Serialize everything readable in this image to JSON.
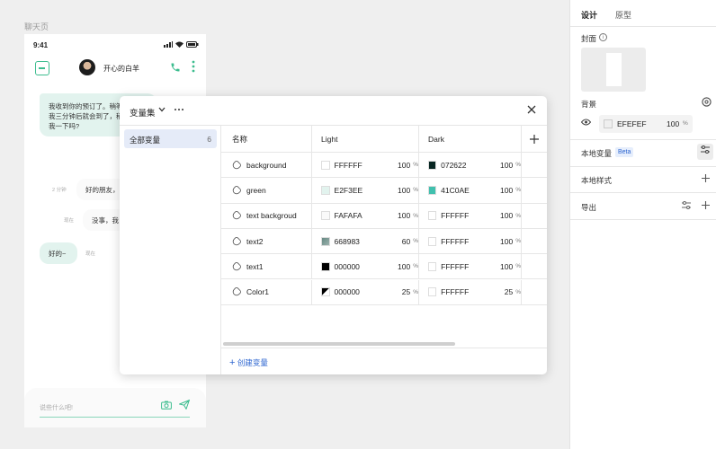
{
  "canvas": {
    "frame_label": "聊天页"
  },
  "phone": {
    "time": "9:41",
    "contact_name": "开心的白羊",
    "messages": [
      {
        "text_lines": [
          "我收到你的预订了。稍等",
          "我三分钟后就会到了，稍",
          "我一下吗?"
        ],
        "side": "left",
        "style": "green"
      },
      {
        "text": "好的朋友，",
        "time": "2 分钟",
        "style": "white"
      },
      {
        "text": "没事，我",
        "time": "现在",
        "style": "white"
      },
      {
        "text": "好的~",
        "time": "现在",
        "style": "green"
      }
    ],
    "input_placeholder": "说些什么吧!"
  },
  "modal": {
    "title": "变量集",
    "collections": [
      {
        "label": "全部变量",
        "count": "6"
      }
    ],
    "columns": {
      "name": "名称",
      "light": "Light",
      "dark": "Dark"
    },
    "pct_symbol": "%",
    "rows": [
      {
        "name": "background",
        "light": {
          "hex": "FFFFFF",
          "opacity": "100",
          "color": "#FFFFFF"
        },
        "dark": {
          "hex": "072622",
          "opacity": "100",
          "color": "#072622"
        }
      },
      {
        "name": "green",
        "light": {
          "hex": "E2F3EE",
          "opacity": "100",
          "color": "#E2F3EE"
        },
        "dark": {
          "hex": "41C0AE",
          "opacity": "100",
          "color": "#41C0AE"
        }
      },
      {
        "name": "text backgroud",
        "light": {
          "hex": "FAFAFA",
          "opacity": "100",
          "color": "#FAFAFA"
        },
        "dark": {
          "hex": "FFFFFF",
          "opacity": "100",
          "color": "#FFFFFF"
        }
      },
      {
        "name": "text2",
        "light": {
          "hex": "668983",
          "opacity": "60",
          "color": "#668983"
        },
        "dark": {
          "hex": "FFFFFF",
          "opacity": "100",
          "color": "#FFFFFF"
        }
      },
      {
        "name": "text1",
        "light": {
          "hex": "000000",
          "opacity": "100",
          "color": "#000000"
        },
        "dark": {
          "hex": "FFFFFF",
          "opacity": "100",
          "color": "#FFFFFF"
        }
      },
      {
        "name": "Color1",
        "light": {
          "hex": "000000",
          "opacity": "25",
          "color": "#000000"
        },
        "dark": {
          "hex": "FFFFFF",
          "opacity": "25",
          "color": "#FFFFFF"
        }
      }
    ],
    "create_label": "创建变量"
  },
  "panel": {
    "tabs": [
      "设计",
      "原型"
    ],
    "cover_title": "封面",
    "background_title": "背景",
    "background": {
      "hex": "EFEFEF",
      "opacity": "100",
      "pct": "%",
      "color": "#EFEFEF"
    },
    "local_variables": "本地变量",
    "beta": "Beta",
    "local_styles": "本地样式",
    "export": "导出"
  },
  "colors": {
    "accent_green": "#3DBD8F",
    "link_blue": "#2E66D0",
    "selected_bg": "#E5EBF8"
  },
  "icons": [
    "chevron-down-icon",
    "more-icon",
    "close-icon",
    "variable-icon",
    "plus-icon",
    "info-icon",
    "eye-icon",
    "style-icon",
    "tune-icon",
    "phone-icon",
    "camera-icon",
    "send-icon"
  ]
}
